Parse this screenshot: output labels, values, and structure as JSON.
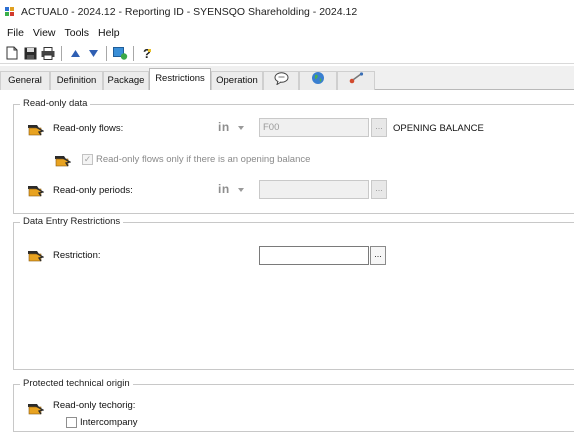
{
  "window": {
    "title": "ACTUAL0 - 2024.12 - Reporting ID - SYENSQO Shareholding - 2024.12",
    "app_icon": "grid-app-icon"
  },
  "menu": [
    "File",
    "View",
    "Tools",
    "Help"
  ],
  "toolbar": {
    "buttons": [
      "new-document-icon",
      "save-icon",
      "print-icon",
      "arrow-up-icon",
      "arrow-down-icon",
      "run-icon",
      "help-icon"
    ]
  },
  "tabs": {
    "general": "General",
    "definition": "Definition",
    "package": "Package",
    "restrictions": "Restrictions",
    "operation": "Operation",
    "comment_icon": "speech-bubble-icon",
    "globe_icon": "globe-icon",
    "link_icon": "link-icon",
    "active": "restrictions"
  },
  "readonly_data": {
    "legend": "Read-only data",
    "flows": {
      "label": "Read-only flows:",
      "operator": "in",
      "value": "F00",
      "ellipsis": "...",
      "description": "OPENING BALANCE"
    },
    "opening_balance_check": {
      "label": "Read-only flows only if there is an opening balance",
      "checked": true,
      "mark": "✓"
    },
    "periods": {
      "label": "Read-only periods:",
      "operator": "in",
      "value": "",
      "ellipsis": "..."
    }
  },
  "data_entry": {
    "legend": "Data Entry Restrictions",
    "restriction": {
      "label": "Restriction:",
      "value": "",
      "ellipsis": "..."
    }
  },
  "technical_origin": {
    "legend": "Protected technical origin",
    "techorig": {
      "label": "Read-only techorig:"
    },
    "intercompany": {
      "label": "Intercompany",
      "checked": false
    }
  },
  "colors": {
    "accent_icon": "#e8a321",
    "icon_dark": "#2a2a2a"
  }
}
